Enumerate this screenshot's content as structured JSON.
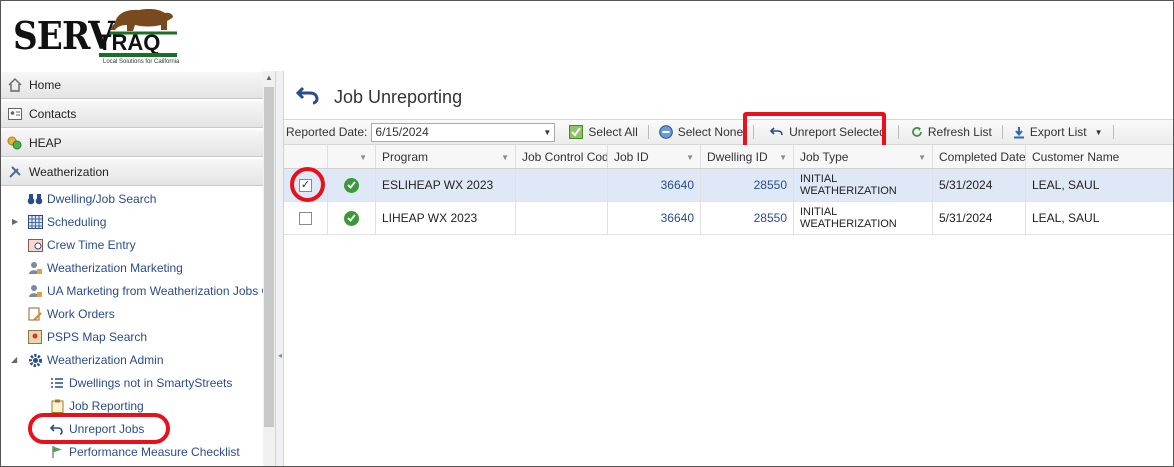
{
  "logo": {
    "word1": "SERV",
    "word2": "TRAQ",
    "tagline": "Local Solutions for California"
  },
  "sidebar": {
    "panels": [
      {
        "label": "Home",
        "icon": "home-icon"
      },
      {
        "label": "Contacts",
        "icon": "contacts-icon"
      },
      {
        "label": "HEAP",
        "icon": "coins-icon"
      },
      {
        "label": "Weatherization",
        "icon": "tools-icon"
      }
    ],
    "items": [
      {
        "label": "Dwelling/Job Search",
        "icon": "binoculars-icon"
      },
      {
        "label": "Scheduling",
        "icon": "calendar-grid-icon"
      },
      {
        "label": "Crew Time Entry",
        "icon": "timesheet-icon"
      },
      {
        "label": "Weatherization Marketing",
        "icon": "user-marketing-icon"
      },
      {
        "label": "UA Marketing from Weatherization Jobs C",
        "icon": "user-marketing-icon"
      },
      {
        "label": "Work Orders",
        "icon": "work-order-icon"
      },
      {
        "label": "PSPS Map Search",
        "icon": "map-icon"
      },
      {
        "label": "Weatherization Admin",
        "icon": "gear-icon"
      },
      {
        "label": "Dwellings not in SmartyStreets",
        "icon": "list-icon"
      },
      {
        "label": "Job Reporting",
        "icon": "clipboard-icon"
      },
      {
        "label": "Unreport Jobs",
        "icon": "undo-icon"
      },
      {
        "label": "Performance Measure Checklist",
        "icon": "flag-icon"
      }
    ]
  },
  "main": {
    "title": "Job Unreporting",
    "toolbar": {
      "reported_date_label": "Reported Date:",
      "reported_date_value": "6/15/2024",
      "select_all": "Select All",
      "select_none": "Select None",
      "unreport_selected": "Unreport Selected",
      "refresh_list": "Refresh List",
      "export_list": "Export List"
    },
    "grid": {
      "columns": [
        "",
        "",
        "Program",
        "Job Control Code",
        "Job ID",
        "Dwelling ID",
        "Job Type",
        "Completed Date",
        "Customer Name"
      ],
      "rows": [
        {
          "checked": true,
          "check_glyph": "✓",
          "program": "ESLIHEAP WX 2023",
          "job_control_code": "",
          "job_id": "36640",
          "dwelling_id": "28550",
          "job_type_line1": "INITIAL",
          "job_type_line2": "WEATHERIZATION",
          "completed_date": "5/31/2024",
          "customer_name": "LEAL, SAUL"
        },
        {
          "checked": false,
          "check_glyph": "",
          "program": "LIHEAP WX 2023",
          "job_control_code": "",
          "job_id": "36640",
          "dwelling_id": "28550",
          "job_type_line1": "INITIAL",
          "job_type_line2": "WEATHERIZATION",
          "completed_date": "5/31/2024",
          "customer_name": "LEAL, SAUL"
        }
      ]
    }
  },
  "colors": {
    "accent_blue": "#2a4d8a",
    "annotation_red": "#e8101a",
    "selected_row": "#dfe8f6",
    "status_green": "#3a9a3a"
  }
}
